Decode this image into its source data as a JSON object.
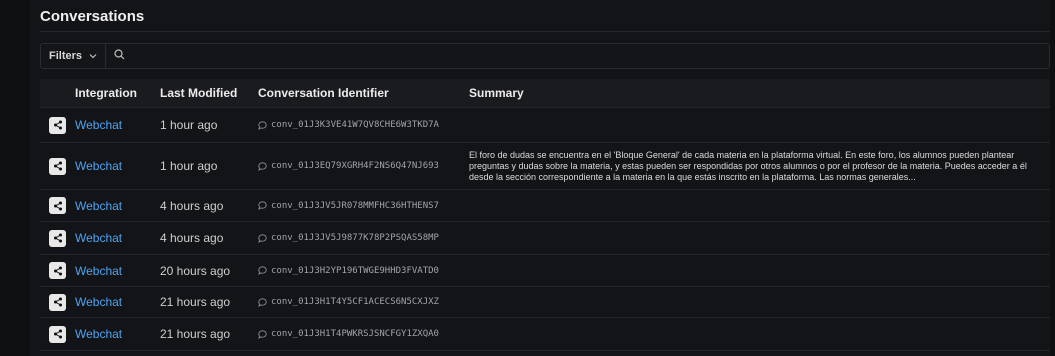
{
  "page": {
    "title": "Conversations"
  },
  "toolbar": {
    "filters_label": "Filters"
  },
  "table": {
    "columns": [
      "Integration",
      "Last Modified",
      "Conversation Identifier",
      "Summary"
    ],
    "rows": [
      {
        "integration": "Webchat",
        "modified": "1 hour ago",
        "id": "conv_01J3K3VE41W7QV8CHE6W3TKD7A",
        "summary": ""
      },
      {
        "integration": "Webchat",
        "modified": "1 hour ago",
        "id": "conv_01J3EQ79XGRH4F2NS6Q47NJ693",
        "summary": "El foro de dudas se encuentra en el 'Bloque General' de cada materia en la plataforma virtual. En este foro, los alumnos pueden plantear preguntas y dudas sobre la materia, y estas pueden ser respondidas por otros alumnos o por el profesor de la materia. Puedes acceder a él desde la sección correspondiente a la materia en la que estás inscrito en la plataforma. Las normas generales..."
      },
      {
        "integration": "Webchat",
        "modified": "4 hours ago",
        "id": "conv_01J3JV5JR078MMFHC36HTHENS7",
        "summary": ""
      },
      {
        "integration": "Webchat",
        "modified": "4 hours ago",
        "id": "conv_01J3JV5J9877K78P2PSQAS58MP",
        "summary": ""
      },
      {
        "integration": "Webchat",
        "modified": "20 hours ago",
        "id": "conv_01J3H2YP196TWGE9HHD3FVATD0",
        "summary": ""
      },
      {
        "integration": "Webchat",
        "modified": "21 hours ago",
        "id": "conv_01J3H1T4Y5CF1ACECS6N5CXJXZ",
        "summary": ""
      },
      {
        "integration": "Webchat",
        "modified": "21 hours ago",
        "id": "conv_01J3H1T4PWKRSJSNCFGY1ZXQA0",
        "summary": ""
      }
    ]
  },
  "colors": {
    "background": "#131417",
    "link": "#4fa3f0",
    "border": "#24262b"
  },
  "icons": {
    "integration": "share-icon",
    "conversation": "chat-bubble-icon",
    "filters_chevron": "chevron-down-icon",
    "search": "search-icon"
  }
}
